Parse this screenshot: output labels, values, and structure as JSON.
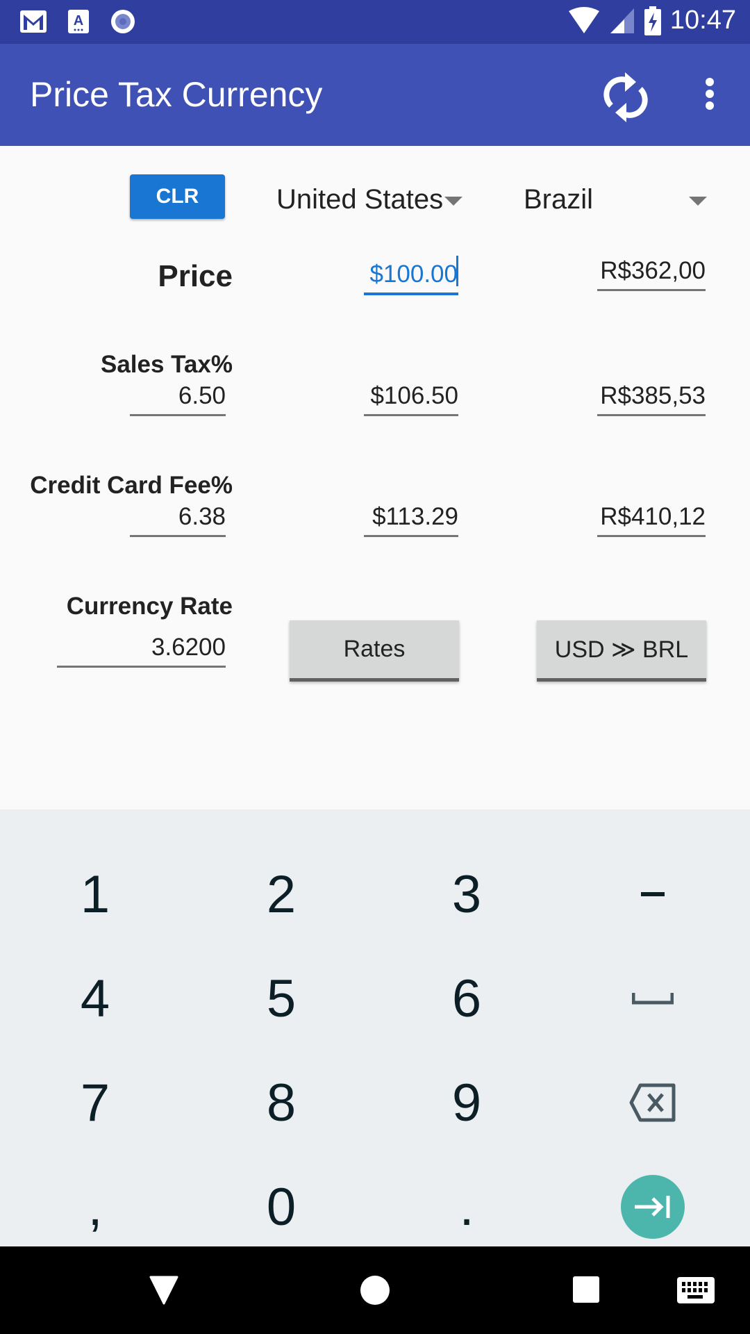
{
  "status_bar": {
    "time": "10:47",
    "left_icons": [
      "gmail-icon",
      "accessibility-icon",
      "record-icon"
    ],
    "right_icons": [
      "wifi-icon",
      "signal-icon",
      "battery-charging-icon"
    ]
  },
  "app_bar": {
    "title": "Price Tax Currency",
    "actions": [
      "refresh-icon",
      "more-options-icon"
    ]
  },
  "controls": {
    "clear_label": "CLR",
    "from_country": "United States",
    "to_country": "Brazil"
  },
  "rows": {
    "price": {
      "label": "Price",
      "from_value": "$100.00",
      "to_value": "R$362,00"
    },
    "sales_tax": {
      "label": "Sales Tax%",
      "input": "6.50",
      "from_value": "$106.50",
      "to_value": "R$385,53"
    },
    "credit_card_fee": {
      "label": "Credit Card Fee%",
      "input": "6.38",
      "from_value": "$113.29",
      "to_value": "R$410,12"
    },
    "currency_rate": {
      "label": "Currency Rate",
      "input": "3.6200",
      "rates_label": "Rates",
      "swap_label": "USD ≫ BRL"
    }
  },
  "keyboard": {
    "keys": [
      [
        "1",
        "2",
        "3",
        "-"
      ],
      [
        "4",
        "5",
        "6",
        "space"
      ],
      [
        "7",
        "8",
        "9",
        "backspace"
      ],
      [
        ",",
        "0",
        ".",
        "next"
      ]
    ],
    "accent_color": "#4db6ac"
  },
  "nav_bar": {
    "buttons": [
      "back-icon",
      "home-icon",
      "recents-icon",
      "keyboard-icon"
    ]
  },
  "colors": {
    "status_bar": "#303f9f",
    "app_bar": "#3f51b5",
    "accent": "#1976d2"
  }
}
